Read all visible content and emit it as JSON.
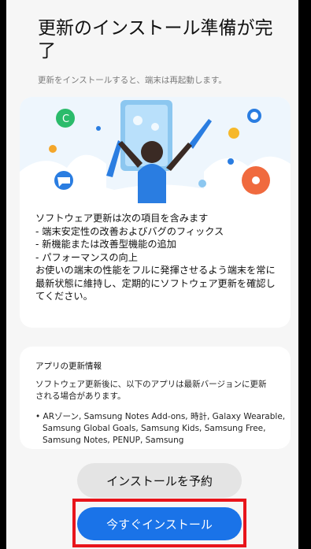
{
  "header": {
    "title": "更新のインストール準備が完了",
    "subtitle": "更新をインストールすると、端末は再起動します。"
  },
  "update_card": {
    "illustration": "celebration-person-illustration",
    "text": "ソフトウェア更新は次の項目を含みます\n - 端末安定性の改善およびバグのフィックス\n - 新機能または改善型機能の追加\n - パフォーマンスの向上\nお使いの端末の性能をフルに発揮させるよう端末を常に最新状態に維持し、定期的にソフトウェア更新を確認してください。"
  },
  "app_card": {
    "title": "アプリの更新情報",
    "description": "ソフトウェア更新後に、以下のアプリは最新バージョンに更新される場合があります。",
    "apps": "• ARゾーン, Samsung Notes Add-ons, 時計, Galaxy Wearable, Samsung Global Goals, Samsung Kids, Samsung Free, Samsung Notes, PENUP, Samsung"
  },
  "buttons": {
    "schedule_label": "インストールを予約",
    "install_now_label": "今すぐインストール"
  },
  "colors": {
    "primary": "#1a73e8",
    "highlight": "#e8141b",
    "background": "#f6f6f6"
  }
}
